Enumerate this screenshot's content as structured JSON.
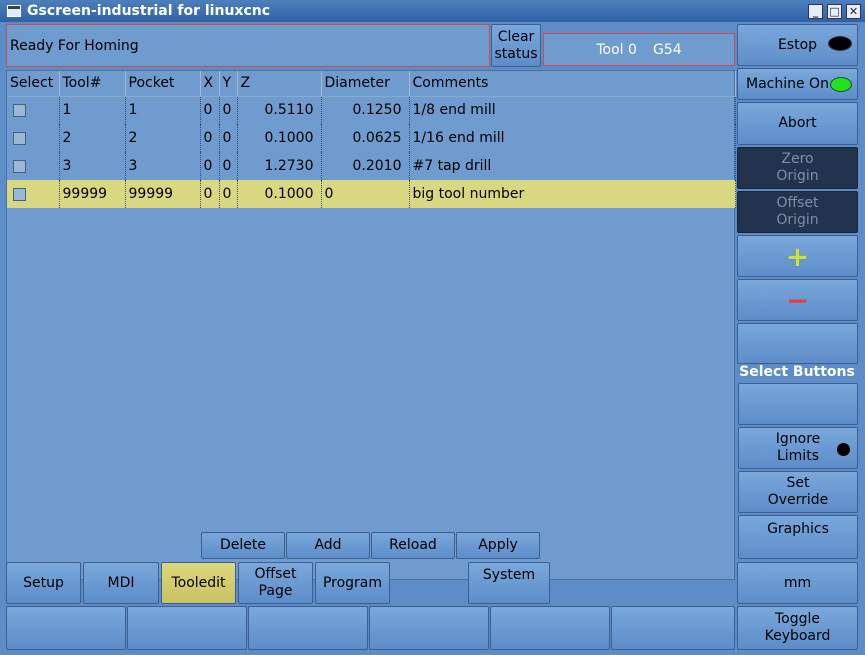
{
  "window": {
    "title": "Gscreen-industrial for linuxcnc"
  },
  "status": {
    "message": "Ready For Homing",
    "clear_label": "Clear\nstatus"
  },
  "tool_info": {
    "tool": "Tool 0",
    "coord_system": "G54"
  },
  "table": {
    "headers": [
      "Select",
      "Tool#",
      "Pocket",
      "X",
      "Y",
      "Z",
      "Diameter",
      "Comments"
    ],
    "rows": [
      {
        "tool": "1",
        "pocket": "1",
        "x": "0",
        "y": "0",
        "z": "0.5110",
        "diameter": "0.1250",
        "comment": "1/8 end mill",
        "selected": false
      },
      {
        "tool": "2",
        "pocket": "2",
        "x": "0",
        "y": "0",
        "z": "0.1000",
        "diameter": "0.0625",
        "comment": "1/16 end mill",
        "selected": false
      },
      {
        "tool": "3",
        "pocket": "3",
        "x": "0",
        "y": "0",
        "z": "1.2730",
        "diameter": "0.2010",
        "comment": "#7 tap drill",
        "selected": false
      },
      {
        "tool": "99999",
        "pocket": "99999",
        "x": "0",
        "y": "0",
        "z": "0.1000",
        "diameter": "0",
        "comment": "big tool number",
        "selected": true
      }
    ]
  },
  "table_actions": {
    "delete": "Delete",
    "add": "Add",
    "reload": "Reload",
    "apply": "Apply"
  },
  "bottom_tabs": {
    "setup": "Setup",
    "mdi": "MDI",
    "tooledit": "Tooledit",
    "offset_page": "Offset\nPage",
    "program": "Program",
    "system": "System"
  },
  "side": {
    "estop": "Estop",
    "machine_on": "Machine On",
    "abort": "Abort",
    "zero_origin": "Zero\nOrigin",
    "offset_origin": "Offset\nOrigin",
    "plus": "+",
    "minus": "−",
    "select_buttons": "Select Buttons",
    "ignore_limits": "Ignore\nLimits",
    "set_override": "Set\nOverride",
    "graphics": "Graphics",
    "units": "mm",
    "toggle_keyboard": "Toggle\nKeyboard"
  },
  "colors": {
    "background": "#5d8cc6",
    "selected_row": "#d9d77f",
    "active_tab": "#ddd77c",
    "estop_indicator": "#000000",
    "machine_on_indicator": "#22e022",
    "plus_color": "#c8e04a",
    "minus_color": "#e04040"
  }
}
